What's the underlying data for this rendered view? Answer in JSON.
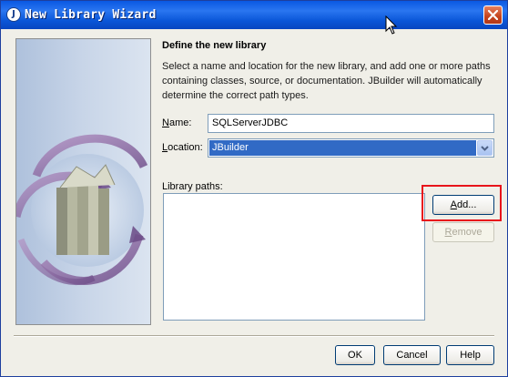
{
  "window": {
    "title": "New Library Wizard",
    "app_icon_glyph": "J"
  },
  "content": {
    "heading": "Define the new library",
    "description": "Select a name and location for the new library, and add one or more paths containing classes, source, or documentation. JBuilder will automatically determine the correct path types."
  },
  "form": {
    "name_label_accel": "N",
    "name_label_rest": "ame:",
    "name_value": "SQLServerJDBC",
    "location_label_accel": "L",
    "location_label_rest": "ocation:",
    "location_value": "JBuilder",
    "library_paths_label": "Library paths:"
  },
  "buttons": {
    "add_accel": "A",
    "add_rest": "dd...",
    "remove_accel": "R",
    "remove_rest": "emove",
    "ok": "OK",
    "cancel": "Cancel",
    "help": "Help"
  },
  "colors": {
    "title_bar": "#0a58e3",
    "selection": "#316ac5",
    "highlight_box": "#e8141b"
  }
}
